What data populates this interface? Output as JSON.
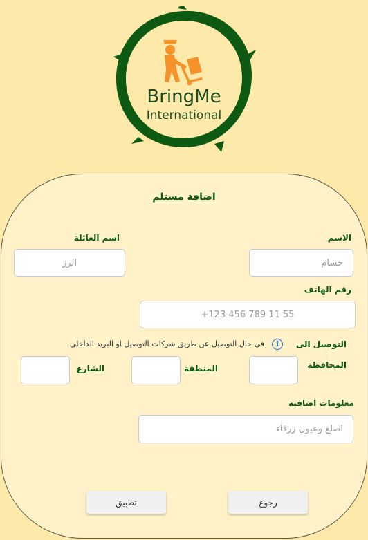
{
  "logo": {
    "brand": "BringMe",
    "subtitle": "International",
    "icon": "delivery-person-icon"
  },
  "form": {
    "title": "اضافة مستلم",
    "first_name": {
      "label": "الاسم",
      "placeholder": "حسام"
    },
    "last_name": {
      "label": "اسم العائلة",
      "placeholder": "الرز"
    },
    "phone": {
      "label": "رقم الهاتف",
      "placeholder": "+123 456 789 11 55"
    },
    "delivery": {
      "label": "التوصيل الى",
      "note": "في حال التوصيل عن طريق شركات التوصيل او البريد الداخلي",
      "info_icon": "info-icon",
      "governorate": {
        "label": "المحافظة",
        "value": ""
      },
      "area": {
        "label": "المنطقة",
        "value": ""
      },
      "street": {
        "label": "الشارع",
        "value": ""
      }
    },
    "extra_info": {
      "label": "معلومات اضافية",
      "placeholder": "اصلع وعيون زرقاء"
    }
  },
  "buttons": {
    "back": "رجوع",
    "apply": "تطبيق"
  },
  "colors": {
    "background": "#fde9aa",
    "card": "#fff2c9",
    "label_green": "#0b5a0f",
    "logo_orange": "#f5922a"
  }
}
